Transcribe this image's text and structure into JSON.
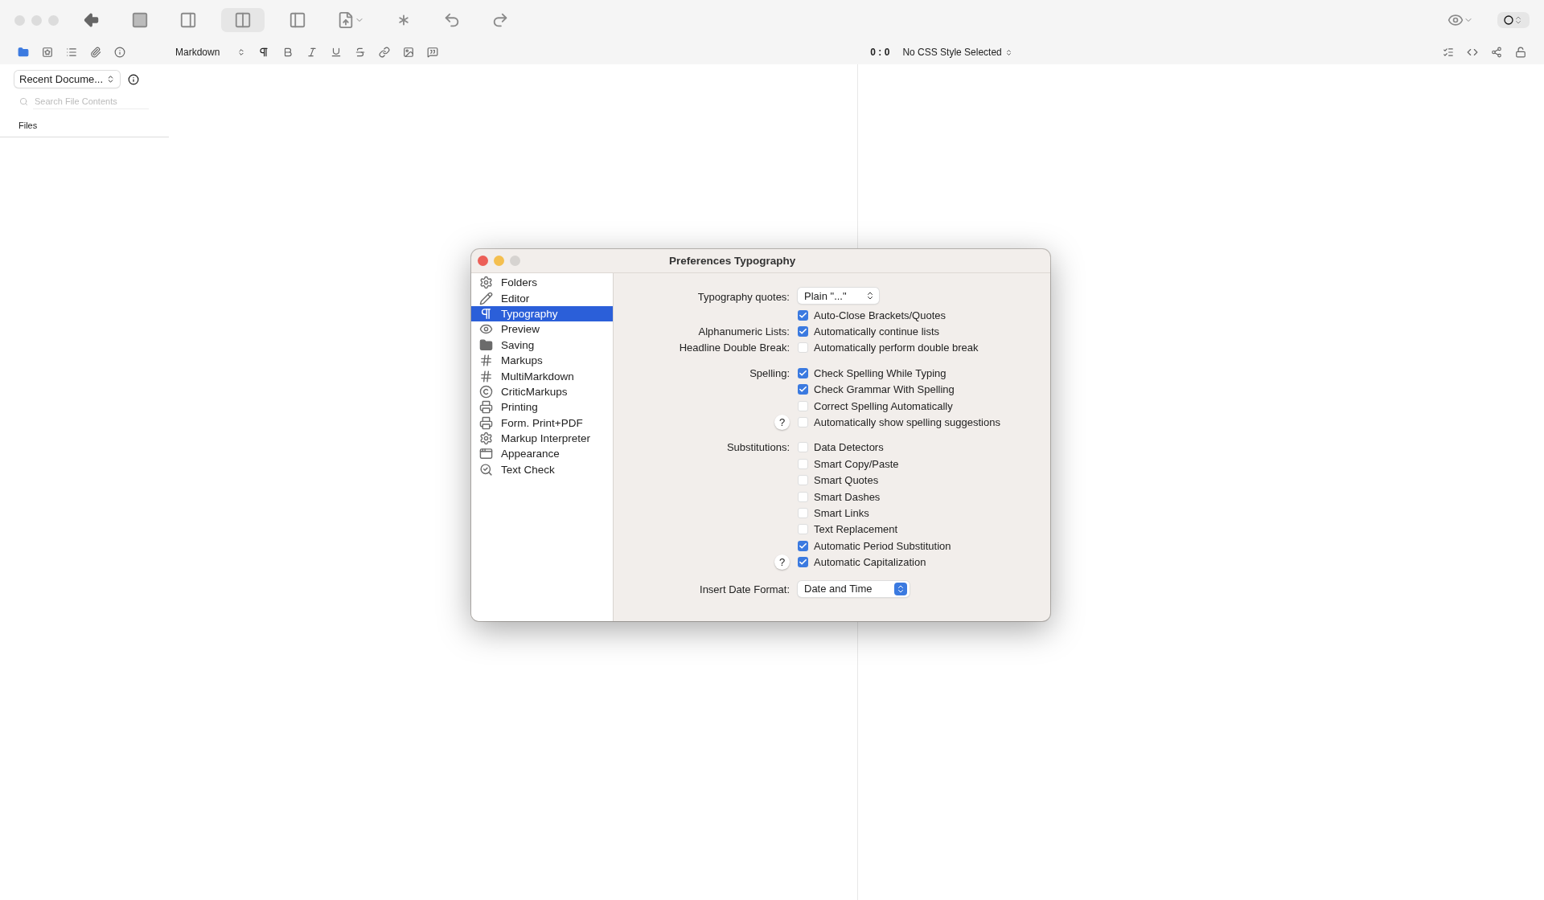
{
  "toolbar": {
    "format": "Markdown",
    "cursor": "0 : 0",
    "css_style": "No CSS Style Selected"
  },
  "sidebar": {
    "recent": "Recent Docume...",
    "search": {
      "placeholder": "Search File Contents"
    },
    "section": "Files"
  },
  "dialog": {
    "title": "Preferences Typography",
    "nav": [
      {
        "label": "Folders",
        "selected": false
      },
      {
        "label": "Editor",
        "selected": false
      },
      {
        "label": "Typography",
        "selected": true
      },
      {
        "label": "Preview",
        "selected": false
      },
      {
        "label": "Saving",
        "selected": false
      },
      {
        "label": "Markups",
        "selected": false
      },
      {
        "label": "MultiMarkdown",
        "selected": false
      },
      {
        "label": "CriticMarkups",
        "selected": false
      },
      {
        "label": "Printing",
        "selected": false
      },
      {
        "label": "Form. Print+PDF",
        "selected": false
      },
      {
        "label": "Markup Interpreter",
        "selected": false
      },
      {
        "label": "Appearance",
        "selected": false
      },
      {
        "label": "Text Check",
        "selected": false
      }
    ],
    "groups": [
      [
        {
          "kind": "select",
          "label": "Typography quotes:",
          "value": "Plain \"...\"",
          "accent": false
        },
        {
          "kind": "checkbox",
          "text": "Auto-Close Brackets/Quotes",
          "checked": true
        },
        {
          "kind": "checkbox",
          "label": "Alphanumeric Lists:",
          "text": "Automatically continue lists",
          "checked": true
        },
        {
          "kind": "checkbox",
          "label": "Headline Double Break:",
          "text": "Automatically perform double break",
          "checked": false
        }
      ],
      [
        {
          "kind": "checkbox",
          "label": "Spelling:",
          "text": "Check Spelling While Typing",
          "checked": true
        },
        {
          "kind": "checkbox",
          "text": "Check Grammar With Spelling",
          "checked": true
        },
        {
          "kind": "checkbox",
          "text": "Correct Spelling Automatically",
          "checked": false
        },
        {
          "kind": "checkbox",
          "help": "?",
          "text": "Automatically show spelling suggestions",
          "checked": false
        }
      ],
      [
        {
          "kind": "checkbox",
          "label": "Substitutions:",
          "text": "Data Detectors",
          "checked": false
        },
        {
          "kind": "checkbox",
          "text": "Smart Copy/Paste",
          "checked": false
        },
        {
          "kind": "checkbox",
          "text": "Smart Quotes",
          "checked": false
        },
        {
          "kind": "checkbox",
          "text": "Smart Dashes",
          "checked": false
        },
        {
          "kind": "checkbox",
          "text": "Smart Links",
          "checked": false
        },
        {
          "kind": "checkbox",
          "text": "Text Replacement",
          "checked": false
        },
        {
          "kind": "checkbox",
          "text": "Automatic Period Substitution",
          "checked": true
        },
        {
          "kind": "checkbox",
          "help": "?",
          "text": "Automatic Capitalization",
          "checked": true
        }
      ],
      [
        {
          "kind": "select",
          "label": "Insert Date Format:",
          "value": "Date and Time",
          "accent": true
        }
      ]
    ]
  }
}
